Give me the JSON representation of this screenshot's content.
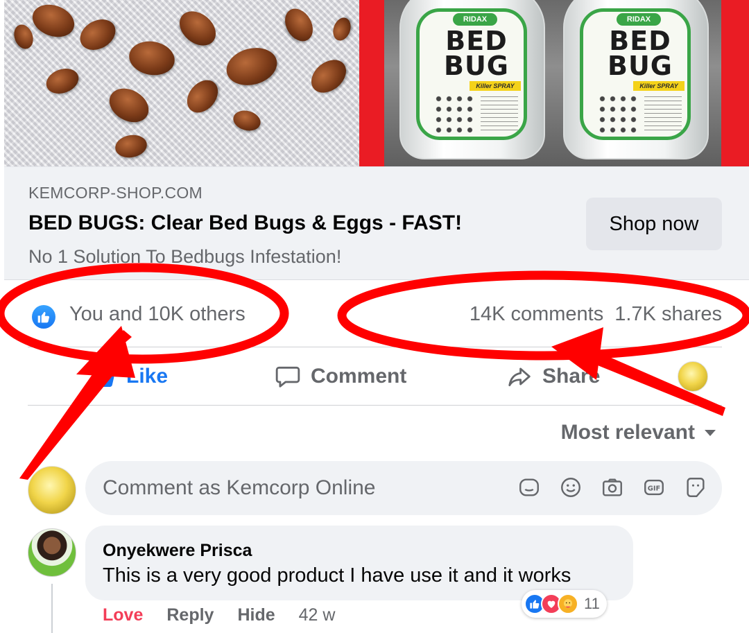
{
  "hero": {
    "bottle_brand": "RIDAX",
    "bottle_title": "BED BUG",
    "bottle_band": "Killer SPRAY"
  },
  "link_card": {
    "domain": "KEMCORP-SHOP.COM",
    "headline": "BED BUGS: Clear Bed Bugs & Eggs - FAST!",
    "description": "No 1 Solution To Bedbugs Infestation!",
    "cta_label": "Shop now"
  },
  "reactions": {
    "summary": "You and 10K others",
    "comments": "14K comments",
    "shares": "1.7K shares"
  },
  "actions": {
    "like": "Like",
    "comment": "Comment",
    "share": "Share"
  },
  "sort": {
    "label": "Most relevant"
  },
  "composer": {
    "placeholder": "Comment as Kemcorp Online",
    "tools": [
      "sticker-icon",
      "emoji-icon",
      "camera-icon",
      "gif-icon",
      "avatar-sticker-icon"
    ]
  },
  "comment": {
    "author": "Onyekwere Prisca",
    "text": "This is a very good product I have use it and it works",
    "reaction_count": "11",
    "reaction_label": "Love",
    "reply": "Reply",
    "hide": "Hide",
    "time": "42 w"
  },
  "colors": {
    "brand_blue": "#1877f2",
    "love_red": "#f33e58",
    "annotation_red": "#ff0000",
    "bottle_green": "#3aa547",
    "panel_red": "#ea1c24"
  }
}
